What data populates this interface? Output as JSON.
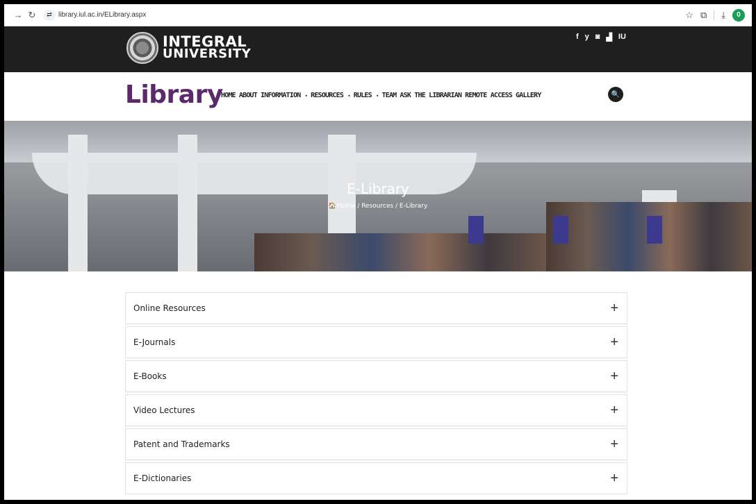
{
  "browser": {
    "url": "library.iul.ac.in/ELibrary.aspx",
    "profile_initial": "0"
  },
  "header": {
    "logo_line1": "INTEGRAL",
    "logo_line2": "UNIVERSITY",
    "social": [
      "f",
      "y",
      "◙",
      "▟",
      "IU"
    ]
  },
  "nav": {
    "title": "Library",
    "items": [
      {
        "label": "HOME",
        "caret": ""
      },
      {
        "label": "ABOUT",
        "caret": ""
      },
      {
        "label": "INFORMATION",
        "caret": "▾"
      },
      {
        "label": "RESOURCES",
        "caret": "▾"
      },
      {
        "label": "RULES",
        "caret": "▾"
      },
      {
        "label": "TEAM",
        "caret": ""
      },
      {
        "label": "ASK THE LIBRARIAN",
        "caret": ""
      },
      {
        "label": "REMOTE ACCESS",
        "caret": ""
      },
      {
        "label": "GALLERY",
        "caret": ""
      }
    ]
  },
  "hero": {
    "title": "E-Library",
    "breadcrumb": "Home / Resources / E-Library"
  },
  "accordion": {
    "items": [
      "Online Resources",
      "E-Journals",
      "E-Books",
      "Video Lectures",
      "Patent and Trademarks",
      "E-Dictionaries"
    ]
  }
}
